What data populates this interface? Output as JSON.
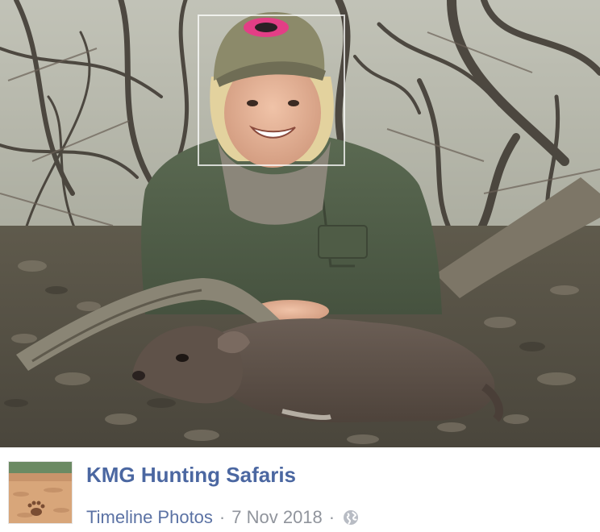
{
  "post": {
    "page_name": "KMG Hunting Safaris",
    "album": "Timeline Photos",
    "separator": "·",
    "date": "7 Nov 2018",
    "privacy_icon": "globe-icon"
  },
  "photo": {
    "tag_box_visible": true
  },
  "colors": {
    "link_blue": "#4b67a1",
    "meta_grey": "#90949c",
    "background": "#ffffff"
  }
}
